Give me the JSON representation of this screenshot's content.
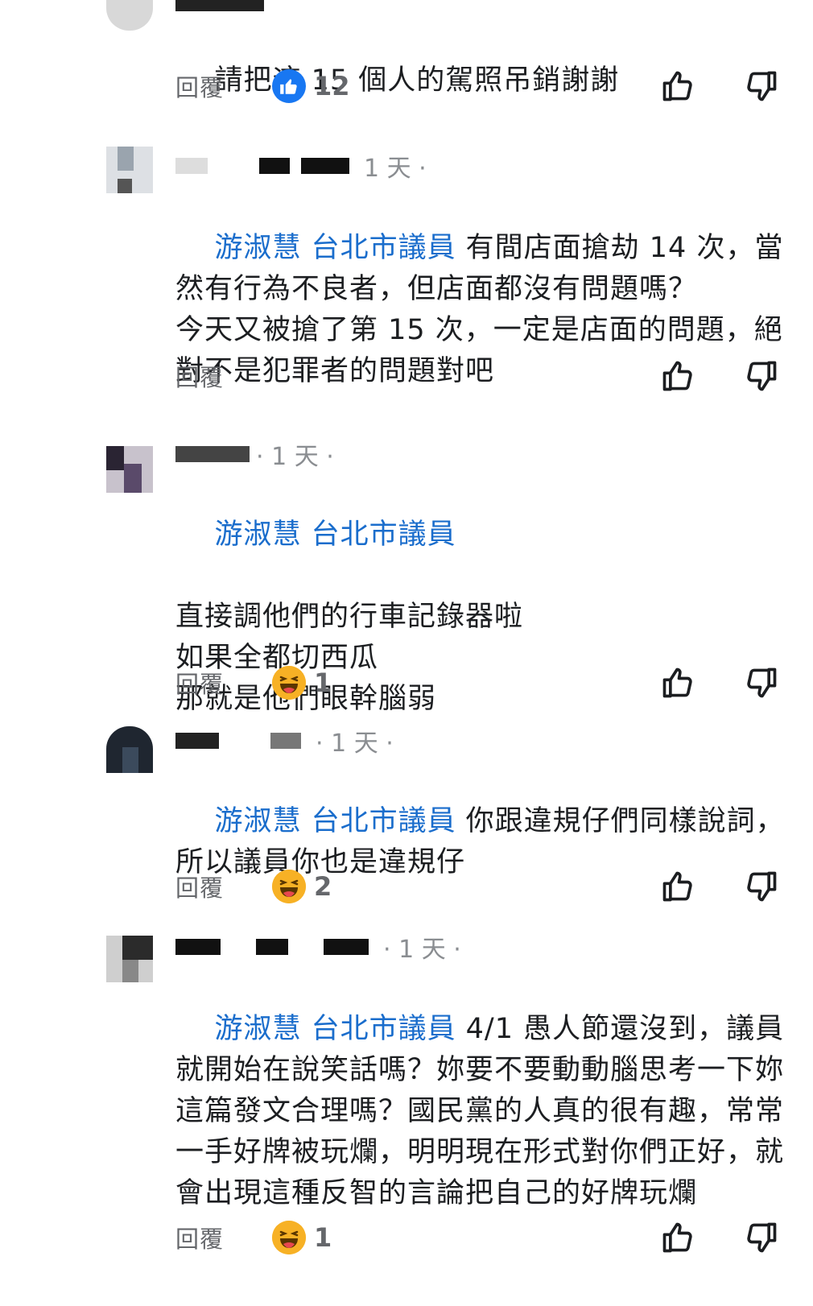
{
  "comments": [
    {
      "time": "",
      "mention": "",
      "text": "請把這 15 個人的駕照吊銷謝謝",
      "reply_label": "回覆",
      "reaction": {
        "type": "like",
        "count": "12"
      }
    },
    {
      "time": "1 天 ·",
      "mention": "游淑慧 台北市議員",
      "text": "有間店面搶劫 14 次，當然有行為不良者，但店面都沒有問題嗎？\n今天又被搶了第 15 次，一定是店面的問題，絕對不是犯罪者的問題對吧",
      "reply_label": "回覆",
      "reaction": null
    },
    {
      "time": "· 1 天 ·",
      "mention": "游淑慧 台北市議員",
      "text": "直接調他們的行車記錄器啦\n如果全都切西瓜\n那就是他們眼幹腦弱",
      "reply_label": "回覆",
      "reaction": {
        "type": "haha",
        "count": "1"
      }
    },
    {
      "time": "· 1 天 ·",
      "mention": "游淑慧 台北市議員",
      "text": "你跟違規仔們同樣說詞，所以議員你也是違規仔",
      "reply_label": "回覆",
      "reaction": {
        "type": "haha",
        "count": "2"
      }
    },
    {
      "time": "· 1 天 ·",
      "mention": "游淑慧 台北市議員",
      "text": "4/1 愚人節還沒到，議員就開始在說笑話嗎？妳要不要動動腦思考一下妳這篇發文合理嗎？國民黨的人真的很有趣，常常一手好牌被玩爛，明明現在形式對你們正好，就會出現這種反智的言論把自己的好牌玩爛",
      "reply_label": "回覆",
      "reaction": {
        "type": "haha",
        "count": "1"
      }
    }
  ],
  "icons": {
    "like": "like-reaction-icon",
    "haha": "haha-reaction-icon",
    "thumbs_up": "thumbs-up-icon",
    "thumbs_down": "thumbs-down-icon"
  },
  "colors": {
    "mention": "#1a6dcc",
    "like_blue": "#1877f2",
    "haha_yellow": "#f7b125",
    "muted": "#65676b"
  }
}
